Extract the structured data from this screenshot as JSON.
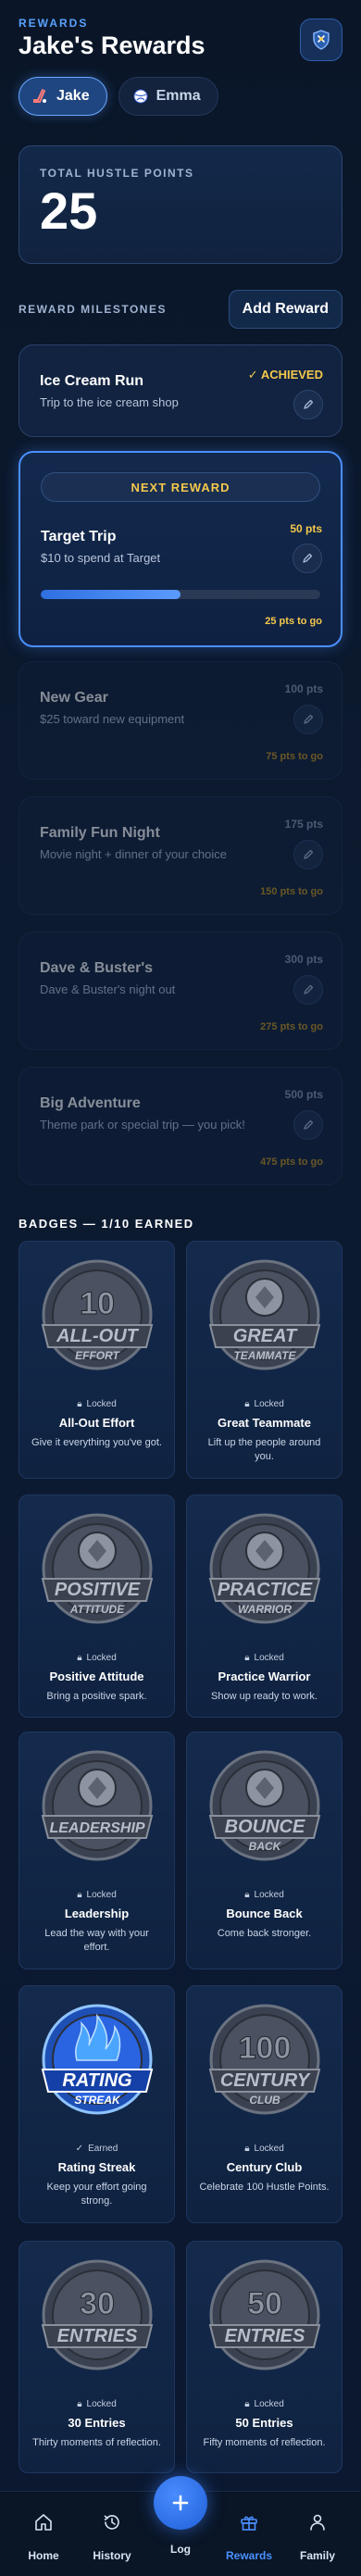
{
  "header": {
    "eyebrow": "REWARDS",
    "title": "Jake's Rewards"
  },
  "kids": [
    {
      "name": "Jake",
      "active": true,
      "icon": "hockey-icon"
    },
    {
      "name": "Emma",
      "active": false,
      "icon": "ball-icon"
    }
  ],
  "points": {
    "label": "TOTAL HUSTLE POINTS",
    "value": "25"
  },
  "milestones_section": {
    "label": "REWARD MILESTONES",
    "add_label": "Add Reward"
  },
  "milestones": [
    {
      "title": "Ice Cream Run",
      "subtitle": "Trip to the ice cream shop",
      "status": "✓ ACHIEVED"
    },
    {
      "pill": "NEXT REWARD",
      "title": "Target Trip",
      "subtitle": "$10 to spend at Target",
      "points": "50 pts",
      "togo": "25 pts to go",
      "progress": 0.5
    },
    {
      "title": "New Gear",
      "subtitle": "$25 toward new equipment",
      "points": "100 pts",
      "togo": "75 pts to go"
    },
    {
      "title": "Family Fun Night",
      "subtitle": "Movie night + dinner of your choice",
      "points": "175 pts",
      "togo": "150 pts to go"
    },
    {
      "title": "Dave & Buster's",
      "subtitle": "Dave & Buster's night out",
      "points": "300 pts",
      "togo": "275 pts to go"
    },
    {
      "title": "Big Adventure",
      "subtitle": "Theme park or special trip — you pick!",
      "points": "500 pts",
      "togo": "475 pts to go"
    }
  ],
  "badges_section": {
    "label": "BADGES — 1/10 EARNED"
  },
  "badges": [
    {
      "name": "All-Out Effort",
      "desc": "Give it everything you've got.",
      "status": "Locked",
      "art_top": "10",
      "art_main": "ALL-OUT",
      "art_sub": "EFFORT"
    },
    {
      "name": "Great Teammate",
      "desc": "Lift up the people around you.",
      "status": "Locked",
      "art_top": "",
      "art_main": "GREAT",
      "art_sub": "TEAMMATE"
    },
    {
      "name": "Positive Attitude",
      "desc": "Bring a positive spark.",
      "status": "Locked",
      "art_top": "",
      "art_main": "POSITIVE",
      "art_sub": "ATTITUDE"
    },
    {
      "name": "Practice Warrior",
      "desc": "Show up ready to work.",
      "status": "Locked",
      "art_top": "",
      "art_main": "PRACTICE",
      "art_sub": "WARRIOR"
    },
    {
      "name": "Leadership",
      "desc": "Lead the way with your effort.",
      "status": "Locked",
      "art_top": "",
      "art_main": "LEADERSHIP",
      "art_sub": ""
    },
    {
      "name": "Bounce Back",
      "desc": "Come back stronger.",
      "status": "Locked",
      "art_top": "",
      "art_main": "BOUNCE",
      "art_sub": "BACK"
    },
    {
      "name": "Rating Streak",
      "desc": "Keep your effort going strong.",
      "status": "Earned",
      "art_top": "",
      "art_main": "RATING",
      "art_sub": "STREAK"
    },
    {
      "name": "Century Club",
      "desc": "Celebrate 100 Hustle Points.",
      "status": "Locked",
      "art_top": "100",
      "art_main": "CENTURY",
      "art_sub": "CLUB"
    },
    {
      "name": "30 Entries",
      "desc": "Thirty moments of reflection.",
      "status": "Locked",
      "art_top": "30",
      "art_main": "ENTRIES",
      "art_sub": ""
    },
    {
      "name": "50 Entries",
      "desc": "Fifty moments of reflection.",
      "status": "Locked",
      "art_top": "50",
      "art_main": "ENTRIES",
      "art_sub": ""
    }
  ],
  "nav": {
    "home": "Home",
    "history": "History",
    "log": "Log",
    "rewards": "Rewards",
    "family": "Family"
  },
  "colors": {
    "accent": "#4a90ff",
    "gold": "#f4c84c",
    "background": "#0b1830"
  }
}
